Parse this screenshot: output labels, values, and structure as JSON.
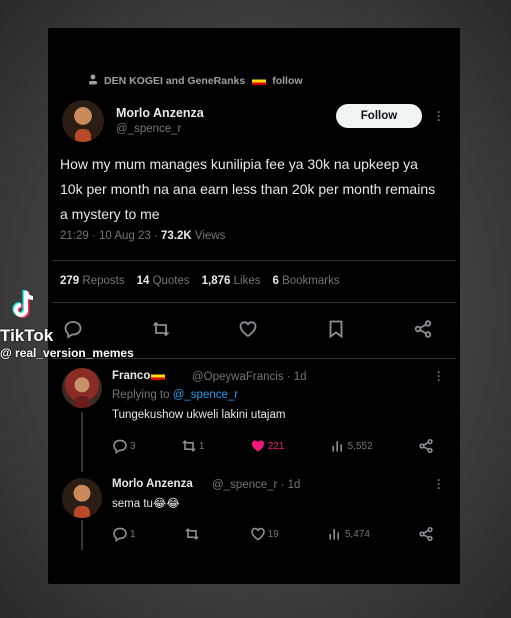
{
  "repost": {
    "text_a": "DEN KOGEI and GeneRanks",
    "text_b": "follow"
  },
  "tweet": {
    "author_name": "Morlo Anzenza",
    "author_handle": "@_spence_r",
    "follow_label": "Follow",
    "text": "How my mum manages kunilipia fee ya 30k na upkeep ya 10k per month na ana earn less than 20k per month remains a mystery to me",
    "time": "21:29 · 10 Aug 23 · ",
    "views_count": "73.2K",
    "views_label": " Views",
    "reposts_count": "279",
    "reposts_label": " Reposts",
    "quotes_count": "14",
    "quotes_label": " Quotes",
    "likes_count": "1,876",
    "likes_label": " Likes",
    "bookmarks_count": "6",
    "bookmarks_label": " Bookmarks"
  },
  "replies": [
    {
      "name": "Franco",
      "handle": "@OpeywaFrancis · 1d",
      "replying_prefix": "Replying to ",
      "replying_handle": "@_spence_r",
      "text": "Tungekushow ukweli lakini utajam",
      "replies": "3",
      "reposts": "1",
      "likes": "221",
      "views": "5,552"
    },
    {
      "name": "Morlo Anzenza",
      "handle": "@_spence_r · 1d",
      "text": "sema tu😂😂",
      "replies": "1",
      "reposts": "",
      "likes": "19",
      "views": "5,474"
    }
  ],
  "overlay": {
    "brand": "TikTok",
    "user": "@ real_version_memes"
  },
  "colors": {
    "accent": "#1d9bf0",
    "like_active": "#f91880",
    "background": "#000000"
  }
}
